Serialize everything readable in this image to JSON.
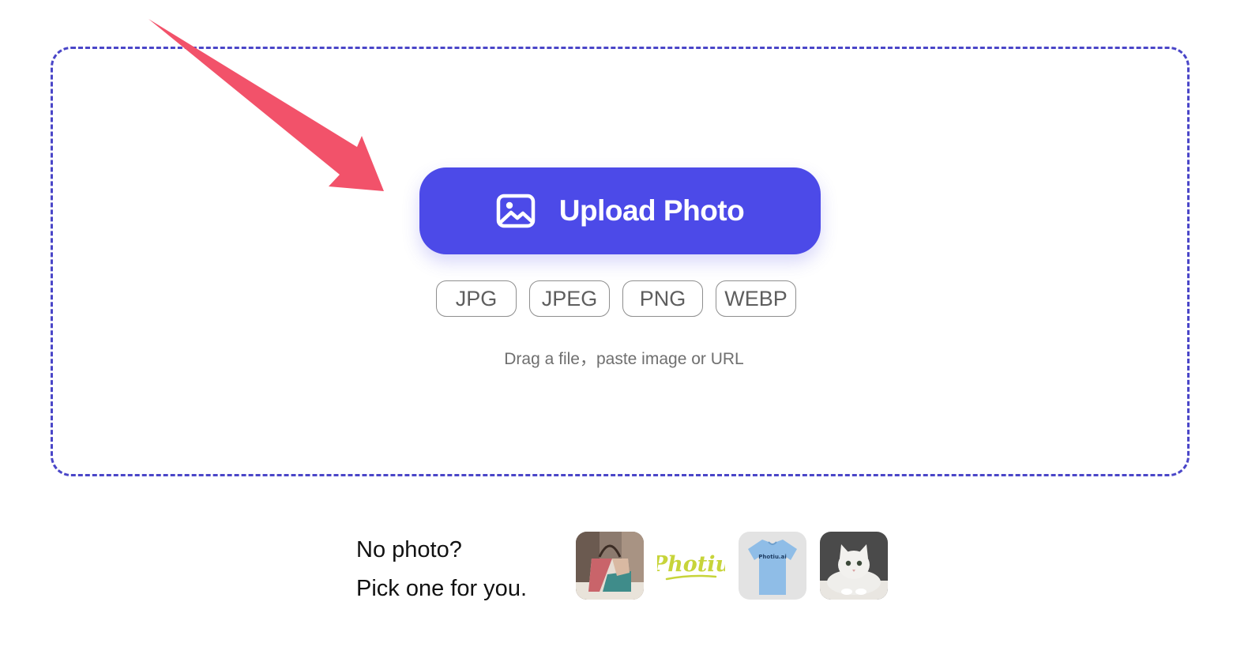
{
  "upload": {
    "button_label": "Upload Photo",
    "icon": "image-icon"
  },
  "formats": [
    "JPG",
    "JPEG",
    "PNG",
    "WEBP"
  ],
  "hint": "Drag a file，paste image or URL",
  "samples": {
    "prompt_line1": "No photo?",
    "prompt_line2": "Pick one for you.",
    "items": [
      {
        "icon": "handbag-image"
      },
      {
        "icon": "photiu-logo-image",
        "text": "Photiu"
      },
      {
        "icon": "tshirt-image",
        "text": "Photiu.ai"
      },
      {
        "icon": "cat-image"
      }
    ]
  },
  "colors": {
    "accent": "#4c4ae8",
    "dashed_border": "#4a46c8",
    "arrow": "#f2526a",
    "chip_border": "#8e8e8e",
    "hint_text": "#6f6f6f"
  }
}
